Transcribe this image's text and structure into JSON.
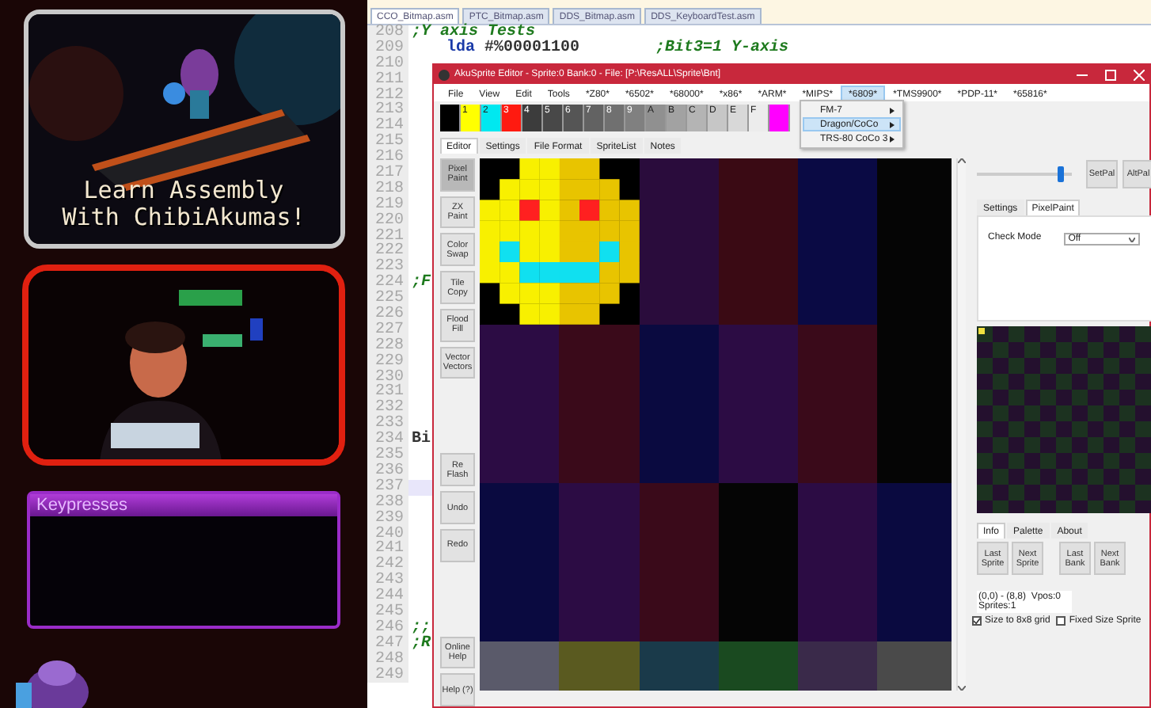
{
  "stream_overlay": {
    "banner": {
      "title_lines": [
        "Learn Assembly",
        "With ChibiAkumas!"
      ]
    },
    "keypresses": {
      "title": "Keypresses"
    }
  },
  "code_editor": {
    "tabs": [
      {
        "label": "CCO_Bitmap.asm",
        "selected": true
      },
      {
        "label": "PTC_Bitmap.asm",
        "selected": false
      },
      {
        "label": "DDS_Bitmap.asm",
        "selected": false
      },
      {
        "label": "DDS_KeyboardTest.asm",
        "selected": false
      }
    ],
    "lines": [
      {
        "number": "208",
        "highlighted": false,
        "segments": [
          {
            "kind": "comment",
            "text": ";Y axis Tests"
          }
        ]
      },
      {
        "number": "209",
        "highlighted": false,
        "segments": [
          {
            "kind": "keyword",
            "text": "lda"
          },
          {
            "kind": "plain",
            "text": "#%00001100"
          },
          {
            "kind": "trailing_comment",
            "text": ";Bit3=1 Y-axis"
          }
        ]
      },
      {
        "number": "210",
        "highlighted": false
      },
      {
        "number": "211",
        "highlighted": false
      },
      {
        "number": "212",
        "highlighted": false
      },
      {
        "number": "213",
        "highlighted": false
      },
      {
        "number": "214",
        "highlighted": false
      },
      {
        "number": "215",
        "highlighted": false
      },
      {
        "number": "216",
        "highlighted": false
      },
      {
        "number": "217",
        "highlighted": false
      },
      {
        "number": "218",
        "highlighted": false
      },
      {
        "number": "219",
        "highlighted": false
      },
      {
        "number": "220",
        "highlighted": false
      },
      {
        "number": "221",
        "highlighted": false
      },
      {
        "number": "222",
        "highlighted": false
      },
      {
        "number": "223",
        "highlighted": false
      },
      {
        "number": "224",
        "highlighted": false,
        "segments": [
          {
            "kind": "comment",
            "text": ";F"
          }
        ]
      },
      {
        "number": "225",
        "highlighted": false
      },
      {
        "number": "226",
        "highlighted": false
      },
      {
        "number": "227",
        "highlighted": false
      },
      {
        "number": "228",
        "highlighted": false
      },
      {
        "number": "229",
        "highlighted": false
      },
      {
        "number": "230",
        "highlighted": false
      },
      {
        "number": "231",
        "highlighted": false
      },
      {
        "number": "232",
        "highlighted": false
      },
      {
        "number": "233",
        "highlighted": false
      },
      {
        "number": "234",
        "highlighted": false,
        "segments": [
          {
            "kind": "plain",
            "text": "Bi"
          }
        ]
      },
      {
        "number": "235",
        "highlighted": false
      },
      {
        "number": "236",
        "highlighted": false
      },
      {
        "number": "237",
        "highlighted": true
      },
      {
        "number": "238",
        "highlighted": false
      },
      {
        "number": "239",
        "highlighted": false
      },
      {
        "number": "240",
        "highlighted": false
      },
      {
        "number": "241",
        "highlighted": false
      },
      {
        "number": "242",
        "highlighted": false
      },
      {
        "number": "243",
        "highlighted": false
      },
      {
        "number": "244",
        "highlighted": false
      },
      {
        "number": "245",
        "highlighted": false
      },
      {
        "number": "246",
        "highlighted": false,
        "segments": [
          {
            "kind": "comment",
            "text": ";;"
          }
        ]
      },
      {
        "number": "247",
        "highlighted": false,
        "segments": [
          {
            "kind": "comment",
            "text": ";R"
          }
        ]
      },
      {
        "number": "248",
        "highlighted": false
      },
      {
        "number": "249",
        "highlighted": false
      }
    ]
  },
  "sprite_window": {
    "title": "AkuSprite Editor - Sprite:0 Bank:0 - File: [P:\\ResALL\\Sprite\\Bnt]",
    "menu": [
      {
        "label": "File",
        "selected": false
      },
      {
        "label": "View",
        "selected": false
      },
      {
        "label": "Edit",
        "selected": false
      },
      {
        "label": "Tools",
        "selected": false
      },
      {
        "label": "*Z80*",
        "selected": false
      },
      {
        "label": "*6502*",
        "selected": false
      },
      {
        "label": "*68000*",
        "selected": false
      },
      {
        "label": "*x86*",
        "selected": false
      },
      {
        "label": "*ARM*",
        "selected": false
      },
      {
        "label": "*MIPS*",
        "selected": false
      },
      {
        "label": "*6809*",
        "selected": true
      },
      {
        "label": "*TMS9900*",
        "selected": false
      },
      {
        "label": "*PDP-11*",
        "selected": false
      },
      {
        "label": "*65816*",
        "selected": false
      }
    ],
    "submenu": [
      {
        "label": "FM-7",
        "selected": false
      },
      {
        "label": "Dragon/CoCo",
        "selected": true
      },
      {
        "label": "TRS-80 CoCo 3",
        "selected": false
      }
    ],
    "palette": [
      {
        "color": "#000000"
      },
      {
        "label": "1",
        "color": "#ffff00"
      },
      {
        "label": "2",
        "color": "#00e8f0"
      },
      {
        "label": "3",
        "color": "#ff1a10"
      },
      {
        "label": "4",
        "color": "#3c3c3c"
      },
      {
        "label": "5",
        "color": "#484848"
      },
      {
        "label": "6",
        "color": "#555555"
      },
      {
        "label": "7",
        "color": "#626262"
      },
      {
        "label": "8",
        "color": "#707070"
      },
      {
        "label": "9",
        "color": "#808080"
      },
      {
        "label": "A",
        "color": "#909090"
      },
      {
        "label": "B",
        "color": "#a2a2a2"
      },
      {
        "label": "C",
        "color": "#b4b4b4"
      },
      {
        "label": "D",
        "color": "#c6c6c6"
      },
      {
        "label": "E",
        "color": "#d8d8d8"
      },
      {
        "label": "F",
        "color": "#ececec"
      },
      {
        "color": "#ff00ff"
      }
    ],
    "tabs": [
      {
        "label": "Editor",
        "selected": true
      },
      {
        "label": "Settings",
        "selected": false
      },
      {
        "label": "File Format",
        "selected": false
      },
      {
        "label": "SpriteList",
        "selected": false
      },
      {
        "label": "Notes",
        "selected": false
      }
    ],
    "tools": [
      {
        "label": "Pixel Paint",
        "kind": "tool",
        "selected": true
      },
      {
        "label": "ZX Paint",
        "kind": "tool",
        "selected": false
      },
      {
        "label": "Color Swap",
        "kind": "tool",
        "selected": false
      },
      {
        "label": "Tile Copy",
        "kind": "tool",
        "selected": false
      },
      {
        "label": "Flood Fill",
        "kind": "tool",
        "selected": false
      },
      {
        "label": "Vector Vectors",
        "kind": "tool",
        "selected": false
      },
      {
        "label": "Re Flash",
        "kind": "action",
        "selected": false
      },
      {
        "label": "Undo",
        "kind": "action",
        "selected": false
      },
      {
        "label": "Redo",
        "kind": "action",
        "selected": false
      },
      {
        "label": "Online Help",
        "kind": "help",
        "selected": false
      },
      {
        "label": "Help (?)",
        "kind": "help",
        "selected": false
      }
    ],
    "slider": {
      "level": 0.88
    },
    "palette_buttons": [
      "SetPal",
      "AltPal"
    ],
    "settings_tabs": [
      {
        "label": "Settings",
        "selected": false
      },
      {
        "label": "PixelPaint",
        "selected": true
      }
    ],
    "check_mode": {
      "label": "Check Mode",
      "value": "Off"
    },
    "info_tabs": [
      {
        "label": "Info",
        "selected": true
      },
      {
        "label": "Palette",
        "selected": false
      },
      {
        "label": "About",
        "selected": false
      }
    ],
    "nav_buttons": [
      "Last Sprite",
      "Next Sprite",
      "Last Bank",
      "Next Bank"
    ],
    "info_lines": [
      "(0,0) - (8,8)  Vpos:0",
      "Sprites:1"
    ],
    "options": [
      {
        "label": "Size to 8x8 grid",
        "checked": true
      },
      {
        "label": "Fixed Size Sprite",
        "checked": false
      }
    ]
  }
}
